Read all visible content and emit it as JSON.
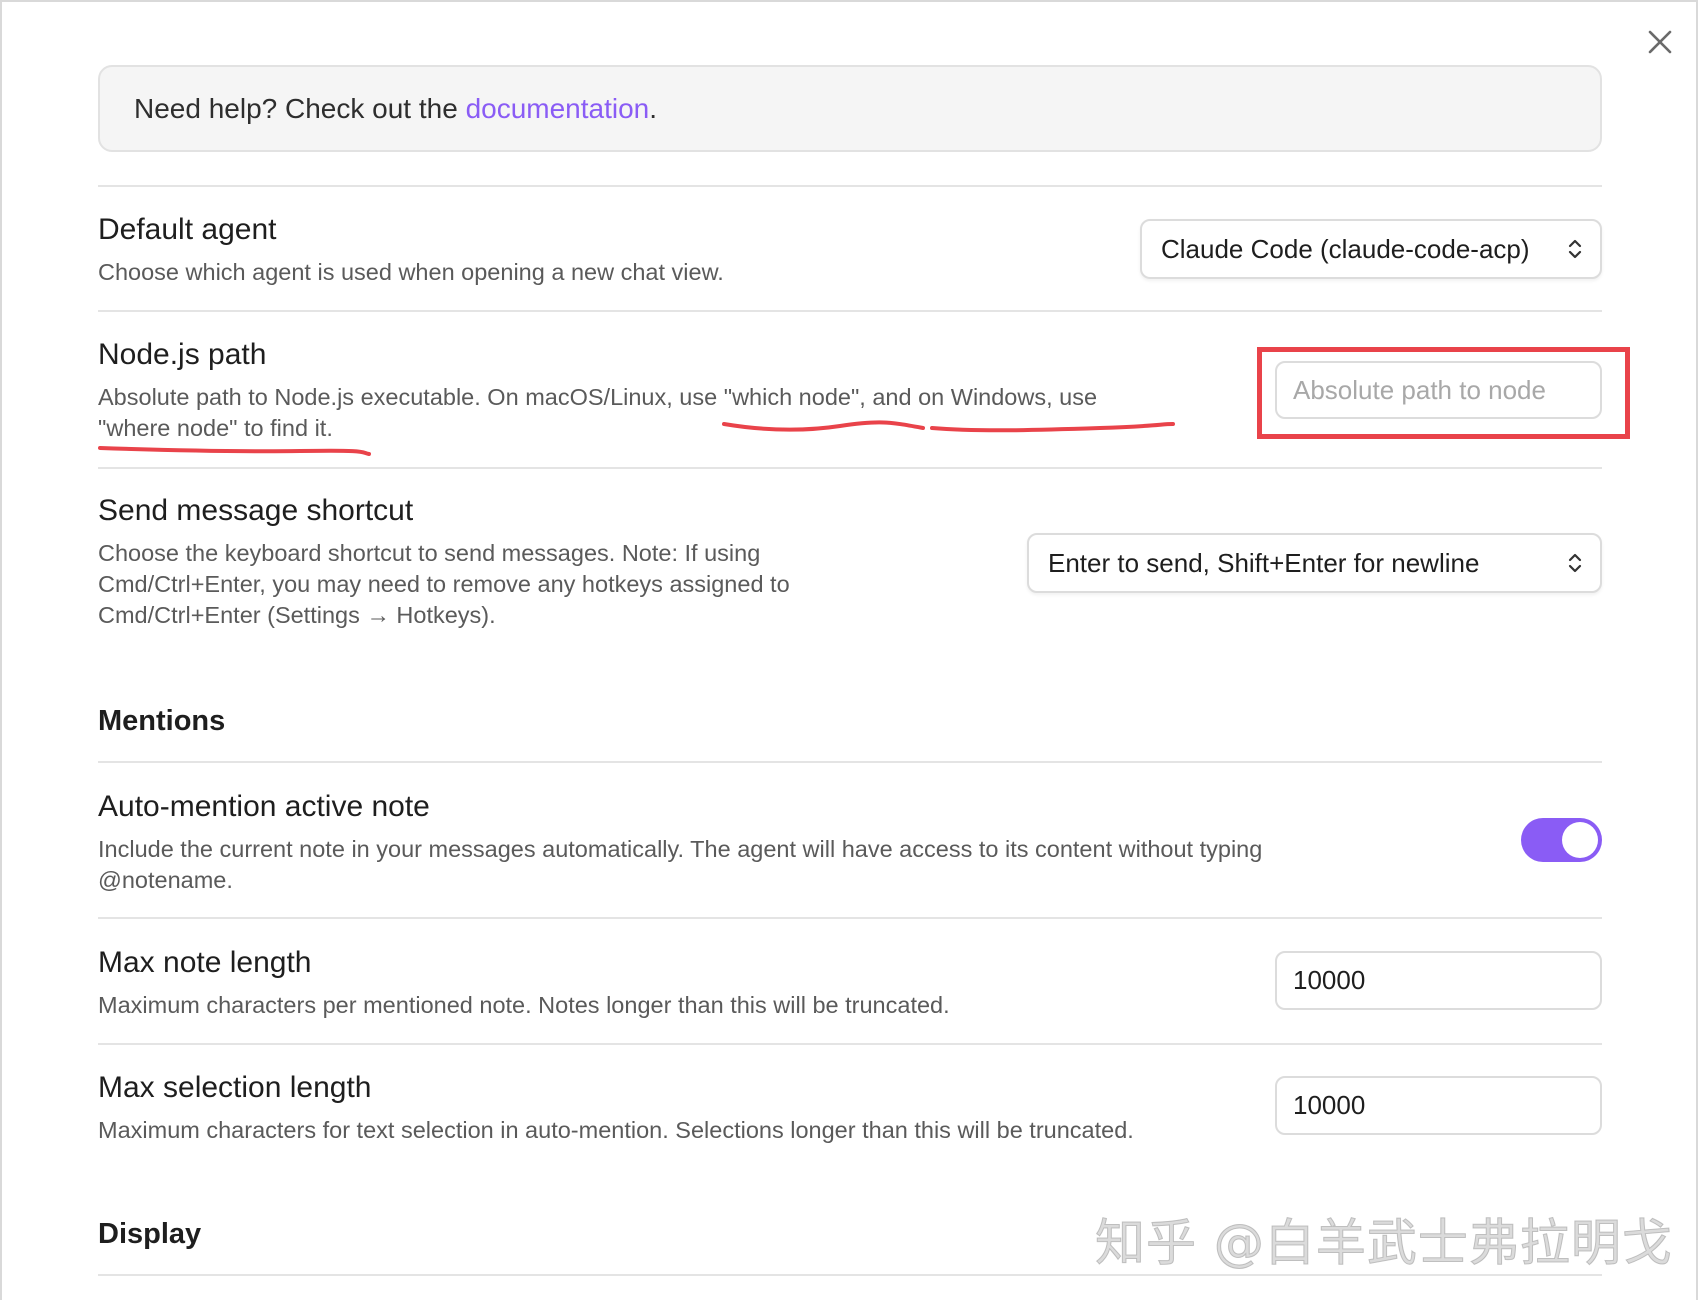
{
  "help": {
    "prefix": "Need help? Check out the ",
    "link": "documentation",
    "suffix": "."
  },
  "default_agent": {
    "title": "Default agent",
    "description": "Choose which agent is used when opening a new chat view.",
    "selected": "Claude Code (claude-code-acp)"
  },
  "node_path": {
    "title": "Node.js path",
    "description_line1": "Absolute path to Node.js executable. On macOS/Linux, use \"which node\", and on Windows, use",
    "description_line2": "\"where node\" to find it.",
    "placeholder": "Absolute path to node"
  },
  "send_shortcut": {
    "title": "Send message shortcut",
    "description_line1": "Choose the keyboard shortcut to send messages. Note: If using",
    "description_line2": "Cmd/Ctrl+Enter, you may need to remove any hotkeys assigned to",
    "description_line3": "Cmd/Ctrl+Enter (Settings → Hotkeys).",
    "selected": "Enter to send, Shift+Enter for newline"
  },
  "mentions": {
    "section_title": "Mentions",
    "auto_mention": {
      "title": "Auto-mention active note",
      "description_line1": "Include the current note in your messages automatically. The agent will have access to its content without typing",
      "description_line2": "@notename.",
      "enabled": true
    },
    "max_note_length": {
      "title": "Max note length",
      "description": "Maximum characters per mentioned note. Notes longer than this will be truncated.",
      "value": "10000"
    },
    "max_selection_length": {
      "title": "Max selection length",
      "description": "Maximum characters for text selection in auto-mention. Selections longer than this will be truncated.",
      "value": "10000"
    }
  },
  "display": {
    "section_title": "Display"
  },
  "watermark": "知乎 @白羊武士弗拉明戈",
  "colors": {
    "accent": "#8a5cf5",
    "annotation_red": "#e9434a"
  },
  "icons": {
    "close": "close-icon",
    "chevron": "chevron-up-down-icon"
  }
}
